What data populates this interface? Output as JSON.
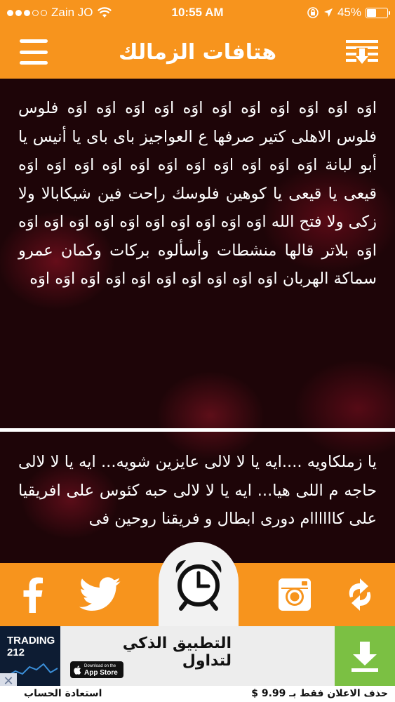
{
  "status_bar": {
    "carrier": "Zain JO",
    "time": "10:55 AM",
    "battery": "45%",
    "battery_level": 0.45
  },
  "nav": {
    "title": "هتافات الزمالك",
    "menu_icon": "hamburger-menu-icon",
    "download_icon": "download-list-icon"
  },
  "chants": [
    {
      "text": "اوَه اوَه اوَه اوَه اوَه اوَه اوَه اوَه اوَه اوَه اوَه فلوس فلوس الاهلى كتير صرفها ع العواجيز باى باى يا أنيس يا أبو لبانة اوَه اوَه اوَه اوَه اوَه اوَه اوَه اوَه اوَه اوَه اوَه قيعى يا قيعى يا كوهين فلوسك راحت فين شيكابالا ولا زكى ولا فتح الله اوَه اوَه اوَه اوَه اوَه اوَه اوَه اوَه اوَه اوَه اوَه بلاتر قالها منشطات وأسألوه بركات وكمان عمرو سماكة الهربان اوَه اوَه اوَه اوَه اوَه اوَه اوَه اوَه اوَه اوَه"
    },
    {
      "text": "يا زملكاويه ....ايه يا لا لالى عايزين شويه... ايه يا لا لالى حاجه م اللى هيا... ايه يا لا لالى حبه كئوس على افريقيا على كاااااام دورى ابطال و فريقنا روحين فى"
    }
  ],
  "toolbar": {
    "facebook_icon": "facebook-icon",
    "twitter_icon": "twitter-icon",
    "alarm_icon": "alarm-clock-icon",
    "instagram_icon": "instagram-icon",
    "refresh_icon": "refresh-arrows-icon"
  },
  "ad": {
    "brand": "TRADING 212",
    "headline": "التطبيق الذكي لتداول",
    "app_store_small": "Download on the",
    "app_store_big": "App Store",
    "close_glyph": "✕",
    "download_icon": "download-arrow-icon"
  },
  "footer": {
    "restore": "استعادة الحساب",
    "remove_ads": "حذف الاعلان فقط بـ 9.99 $"
  },
  "colors": {
    "accent": "#f7941d",
    "background": "#1e0508",
    "ad_green": "#7bc043"
  }
}
